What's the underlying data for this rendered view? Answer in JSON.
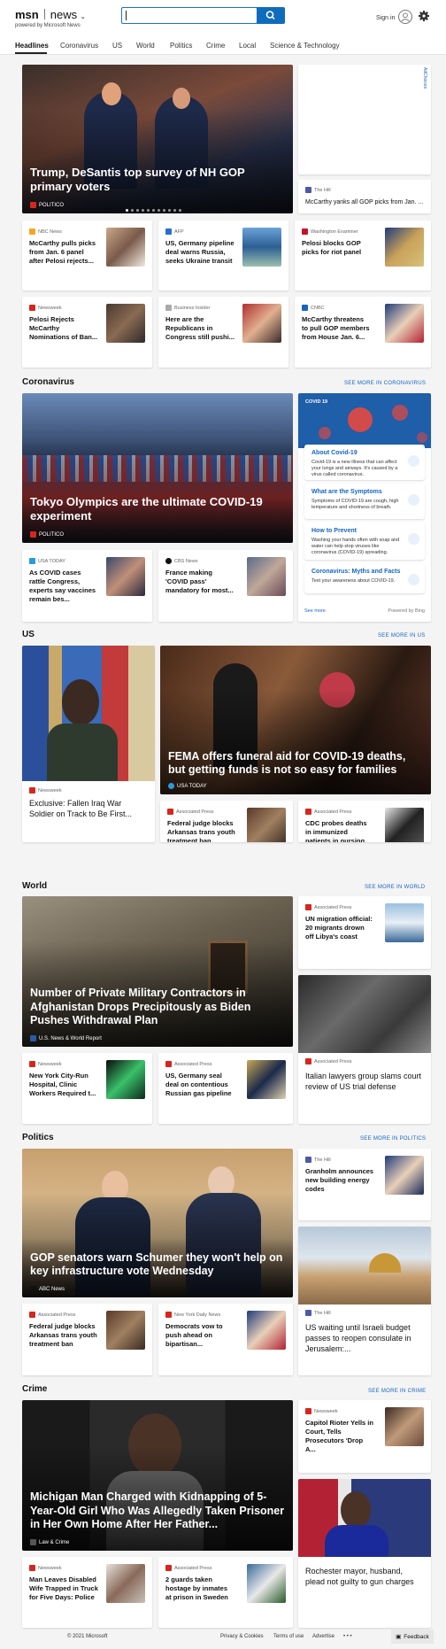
{
  "header": {
    "brand": "msn",
    "section": "news",
    "tagline": "powered by Microsoft News",
    "search_value": "",
    "sign_in": "Sign in"
  },
  "nav": [
    "Headlines",
    "Coronavirus",
    "US",
    "World",
    "Politics",
    "Crime",
    "Local",
    "Science & Technology"
  ],
  "ad": {
    "label": "AdChoices"
  },
  "headlines": {
    "hero": {
      "title": "Trump, DeSantis top survey of NH GOP primary voters",
      "source": "POLITICO"
    },
    "side": {
      "source": "The Hill",
      "text": "McCarthy yanks all GOP picks from Jan. ..."
    },
    "row1": [
      {
        "source": "NBC News",
        "text": "McCarthy pulls picks from Jan. 6 panel after Pelosi rejects..."
      },
      {
        "source": "AFP",
        "text": "US, Germany pipeline deal warns Russia, seeks Ukraine transit"
      },
      {
        "source": "Washington Examiner",
        "text": "Pelosi blocks GOP picks for riot panel"
      }
    ],
    "row2": [
      {
        "source": "Newsweek",
        "text": "Pelosi Rejects McCarthy Nominations of Ban..."
      },
      {
        "source": "Business Insider",
        "text": "Here are the Republicans in Congress still pushi..."
      },
      {
        "source": "CNBC",
        "text": "McCarthy threatens to pull GOP members from House Jan. 6..."
      }
    ]
  },
  "coronavirus": {
    "title": "Coronavirus",
    "see_more": "SEE MORE IN CORONAVIRUS",
    "hero": {
      "title": "Tokyo Olympics are the ultimate COVID-19 experiment",
      "source": "POLITICO"
    },
    "row": [
      {
        "source": "USA TODAY",
        "text": "As COVID cases rattle Congress, experts say vaccines remain bes..."
      },
      {
        "source": "CBS News",
        "text": "France making 'COVID pass' mandatory for most..."
      }
    ],
    "panel": {
      "label": "COVID 19",
      "items": [
        {
          "title": "About Covid-19",
          "desc": "Covid-19 is a new illness that can affect your lungs and airways. It's caused by a virus called coronavirus."
        },
        {
          "title": "What are the Symptoms",
          "desc": "Symptoms of COVID-19 are cough, high temperature and shortness of breath."
        },
        {
          "title": "How to Prevent",
          "desc": "Washing your hands often with soap and water can help stop viruses like coronavirus (COVID-19) spreading."
        },
        {
          "title": "Coronavirus: Myths and Facts",
          "desc": "Test your awareness about COVID-19."
        }
      ],
      "see_more": "See more",
      "powered": "Powered by Bing"
    }
  },
  "us": {
    "title": "US",
    "see_more": "SEE MORE IN US",
    "feature": {
      "source": "Newsweek",
      "text": "Exclusive: Fallen Iraq War Soldier on Track to Be First..."
    },
    "hero": {
      "title": "FEMA offers funeral aid for COVID-19 deaths, but getting funds is not so easy for families",
      "source": "USA TODAY"
    },
    "row": [
      {
        "source": "Associated Press",
        "text": "Federal judge blocks Arkansas trans youth treatment ban"
      },
      {
        "source": "Associated Press",
        "text": "CDC probes deaths in immunized patients in nursing homes"
      }
    ]
  },
  "world": {
    "title": "World",
    "see_more": "SEE MORE IN WORLD",
    "hero": {
      "title": "Number of Private Military Contractors in Afghanistan Drops Precipitously as Biden Pushes Withdrawal Plan",
      "source": "U.S. News & World Report"
    },
    "side": {
      "source": "Associated Press",
      "text": "UN migration official: 20 migrants drown off Libya's coast"
    },
    "tile": {
      "source": "Associated Press",
      "text": "Italian lawyers group slams court review of US trial defense"
    },
    "row": [
      {
        "source": "Newsweek",
        "text": "New York City-Run Hospital, Clinic Workers Required t..."
      },
      {
        "source": "Associated Press",
        "text": "US, Germany seal deal on contentious Russian gas pipeline"
      }
    ]
  },
  "politics": {
    "title": "Politics",
    "see_more": "SEE MORE IN POLITICS",
    "hero": {
      "title": "GOP senators warn Schumer they won't help on key infrastructure vote Wednesday",
      "source": "ABC News"
    },
    "side": {
      "source": "The Hill",
      "text": "Granholm announces new building energy codes"
    },
    "tile": {
      "source": "The Hill",
      "text": "US waiting until Israeli budget passes to reopen consulate in Jerusalem:..."
    },
    "row": [
      {
        "source": "Associated Press",
        "text": "Federal judge blocks Arkansas trans youth treatment ban"
      },
      {
        "source": "New York Daily News",
        "text": "Democrats vow to push ahead on bipartisan..."
      }
    ]
  },
  "crime": {
    "title": "Crime",
    "see_more": "SEE MORE IN CRIME",
    "hero": {
      "title": "Michigan Man Charged with Kidnapping of 5-Year-Old Girl Who Was Allegedly Taken Prisoner in Her Own Home After Her Father...",
      "source": "Law & Crime"
    },
    "side": {
      "source": "Newsweek",
      "text": "Capitol Rioter Yells in Court, Tells Prosecutors 'Drop A..."
    },
    "tile": {
      "text": "Rochester mayor, husband, plead not guilty to gun charges"
    },
    "row": [
      {
        "source": "Newsweek",
        "text": "Man Leaves Disabled Wife Trapped in Truck for Five Days: Police"
      },
      {
        "source": "Associated Press",
        "text": "2 guards taken hostage by inmates at prison in Sweden"
      }
    ]
  },
  "footer": {
    "copyright": "© 2021 Microsoft",
    "privacy": "Privacy & Cookies",
    "terms": "Terms of use",
    "advertise": "Advertise",
    "more": "• • •",
    "feedback": "Feedback"
  }
}
